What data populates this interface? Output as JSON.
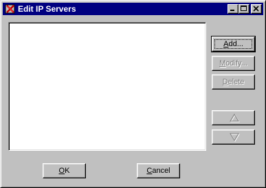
{
  "window": {
    "title": "Edit IP Servers"
  },
  "titlebar_buttons": {
    "minimize_icon": "minimize-icon",
    "maximize_icon": "maximize-icon",
    "close_icon": "close-icon"
  },
  "server_list": {
    "items": []
  },
  "side_buttons": {
    "add": {
      "pre": "",
      "accel": "A",
      "post": "dd...",
      "enabled": true
    },
    "modify": {
      "pre": "",
      "accel": "M",
      "post": "odify...",
      "enabled": false
    },
    "delete": {
      "pre": "",
      "accel": "D",
      "post": "elete",
      "enabled": false
    },
    "move_up_icon": "triangle-up-icon",
    "move_down_icon": "triangle-down-icon"
  },
  "footer": {
    "ok": {
      "pre": "",
      "accel": "O",
      "post": "K"
    },
    "cancel": {
      "pre": "",
      "accel": "C",
      "post": "ancel"
    }
  },
  "colors": {
    "titlebar": "#000080",
    "face": "#c0c0c0",
    "disabled_text": "#808080"
  }
}
